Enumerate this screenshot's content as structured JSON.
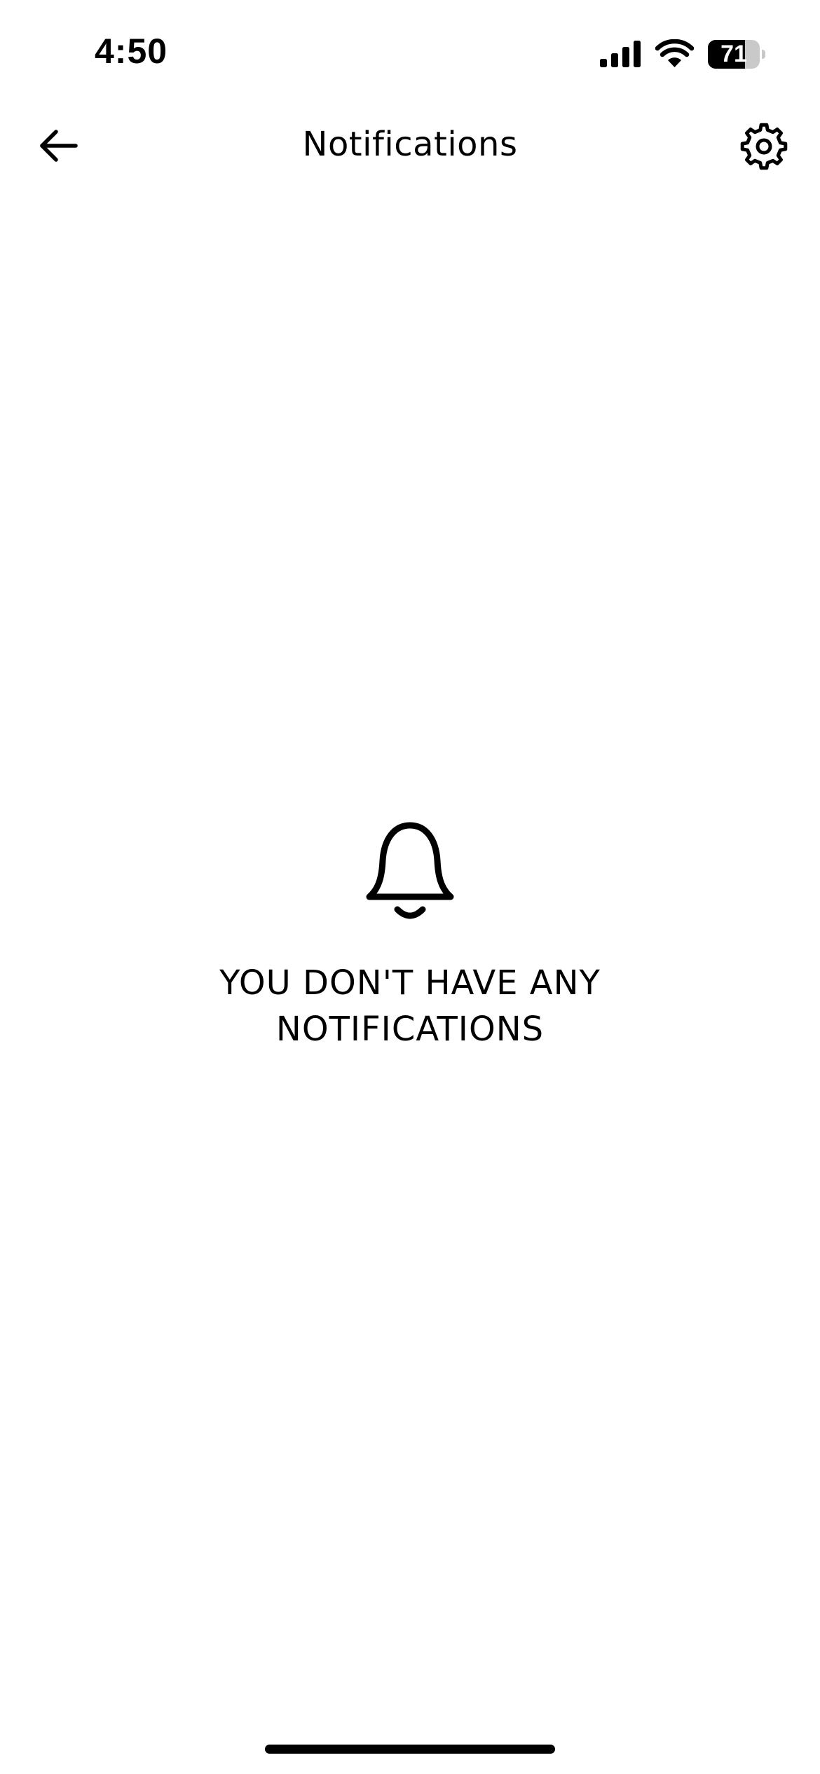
{
  "status_bar": {
    "time": "4:50",
    "battery_percent": "71",
    "battery_level": 0.71,
    "icons": [
      "signal-icon",
      "wifi-icon",
      "battery-icon"
    ]
  },
  "header": {
    "title": "Notifications",
    "left_icon": "back-arrow-icon",
    "right_icon": "gear-icon"
  },
  "empty_state": {
    "icon": "bell-icon",
    "message": "YOU DON'T HAVE ANY NOTIFICATIONS"
  },
  "colors": {
    "background": "#ffffff",
    "foreground": "#000000",
    "battery_track": "#c9c9c9"
  }
}
